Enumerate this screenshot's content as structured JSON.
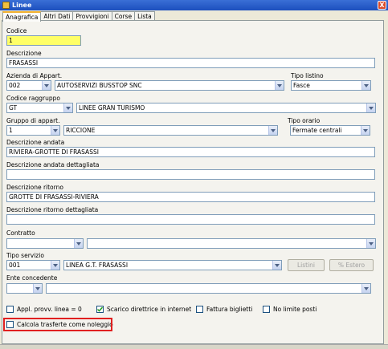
{
  "window": {
    "title": "Linee",
    "close_label": "X"
  },
  "tabs": [
    "Anagrafica",
    "Altri Dati",
    "Provvigioni",
    "Corse",
    "Lista"
  ],
  "fields": {
    "codice": {
      "label": "Codice",
      "value": "1"
    },
    "descrizione": {
      "label": "Descrizione",
      "value": "FRASASSI"
    },
    "azienda": {
      "label": "Azienda di Appart.",
      "code": "002",
      "name": "AUTOSERVIZI BUSSTOP SNC"
    },
    "tipo_listino": {
      "label": "Tipo listino",
      "value": "Fasce"
    },
    "codice_raggruppo": {
      "label": "Codice raggruppo",
      "code": "GT",
      "name": "LINEE GRAN TURISMO"
    },
    "gruppo": {
      "label": "Gruppo di appart.",
      "code": "1",
      "name": "RICCIONE"
    },
    "tipo_orario": {
      "label": "Tipo orario",
      "value": "Fermate centrali"
    },
    "descrizione_andata": {
      "label": "Descrizione andata",
      "value": "RIVIERA-GROTTE DI FRASASSI"
    },
    "descrizione_andata_dett": {
      "label": "Descrizione andata dettagliata",
      "value": ""
    },
    "descrizione_ritorno": {
      "label": "Descrizione ritorno",
      "value": "GROTTE DI FRASASSI-RIVIERA"
    },
    "descrizione_ritorno_dett": {
      "label": "Descrizione ritorno dettagliata",
      "value": ""
    },
    "contratto": {
      "label": "Contratto",
      "code": "",
      "name": ""
    },
    "tipo_servizio": {
      "label": "Tipo servizio",
      "code": "001",
      "name": "LINEA G.T. FRASASSI"
    },
    "ente_concedente": {
      "label": "Ente concedente",
      "code": "",
      "name": ""
    }
  },
  "buttons": {
    "listini": "Listini",
    "estero": "% Estero"
  },
  "checkboxes": [
    {
      "label": "Appl. provv. linea = 0",
      "checked": false
    },
    {
      "label": "Scarico direttrice in internet",
      "checked": true
    },
    {
      "label": "Fattura biglietti",
      "checked": false
    },
    {
      "label": "No limite posti",
      "checked": false
    },
    {
      "label": "Calcola trasferte come noleggio",
      "checked": false
    }
  ],
  "highlight_color": "#e02020"
}
